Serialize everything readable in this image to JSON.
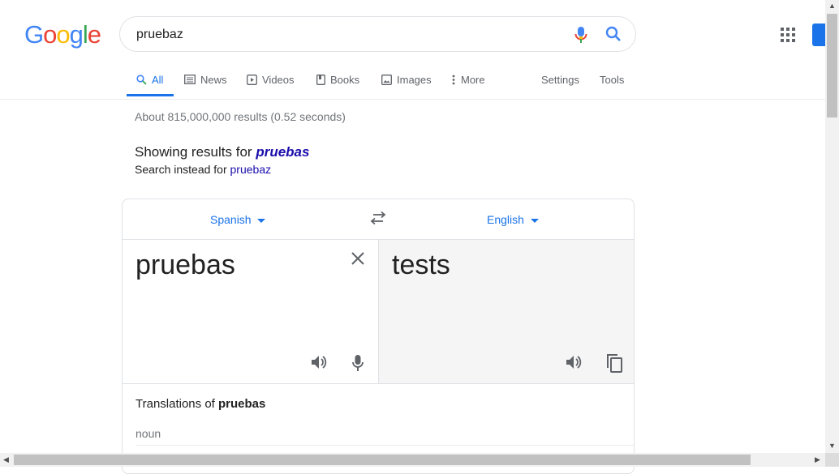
{
  "logo": "Google",
  "search": {
    "query": "pruebaz"
  },
  "tabs": [
    {
      "label": "All",
      "icon": "search-icon",
      "active": true
    },
    {
      "label": "News",
      "icon": "news-icon"
    },
    {
      "label": "Videos",
      "icon": "video-icon"
    },
    {
      "label": "Books",
      "icon": "book-icon"
    },
    {
      "label": "Images",
      "icon": "image-icon"
    },
    {
      "label": "More",
      "icon": "more-vert-icon"
    }
  ],
  "tools": {
    "settings": "Settings",
    "tools": "Tools"
  },
  "stats": "About 815,000,000 results (0.52 seconds)",
  "correction": {
    "showing_prefix": "Showing results for",
    "corrected": "pruebas",
    "instead_prefix": "Search instead for",
    "original": "pruebaz"
  },
  "translator": {
    "source_lang": "Spanish",
    "target_lang": "English",
    "source_text": "pruebas",
    "target_text": "tests",
    "translations_prefix": "Translations of",
    "translations_word": "pruebas",
    "pos": "noun"
  },
  "colors": {
    "accent": "#1a73e8",
    "link": "#1a0dab"
  }
}
